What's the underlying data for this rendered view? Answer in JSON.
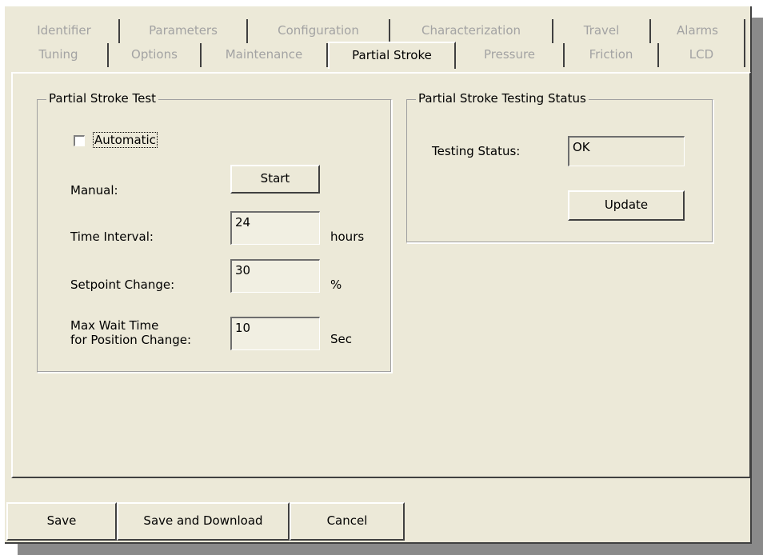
{
  "tabs": {
    "row1": [
      "Identifier",
      "Parameters",
      "Configuration",
      "Characterization",
      "Travel",
      "Alarms"
    ],
    "row2": [
      "Tuning",
      "Options",
      "Maintenance",
      "Partial Stroke",
      "Pressure",
      "Friction",
      "LCD"
    ],
    "selected": "Partial Stroke"
  },
  "partial_stroke_test": {
    "title": "Partial Stroke Test",
    "automatic_label": "Automatic",
    "automatic_checked": false,
    "manual_label": "Manual:",
    "start_button": "Start",
    "time_interval_label": "Time Interval:",
    "time_interval_value": "24",
    "time_interval_unit": "hours",
    "setpoint_change_label": "Setpoint Change:",
    "setpoint_change_value": "30",
    "setpoint_change_unit": "%",
    "max_wait_label_line1": "Max Wait Time",
    "max_wait_label_line2": "for Position Change:",
    "max_wait_value": "10",
    "max_wait_unit": "Sec"
  },
  "testing_status": {
    "title": "Partial Stroke Testing Status",
    "status_label": "Testing Status:",
    "status_value": "OK",
    "update_button": "Update"
  },
  "footer": {
    "save": "Save",
    "save_download": "Save and Download",
    "cancel": "Cancel"
  },
  "colors": {
    "dialog_bg": "#ece9d8",
    "disabled_text": "#a3a3a3",
    "header_text": "#1f4e9c"
  }
}
